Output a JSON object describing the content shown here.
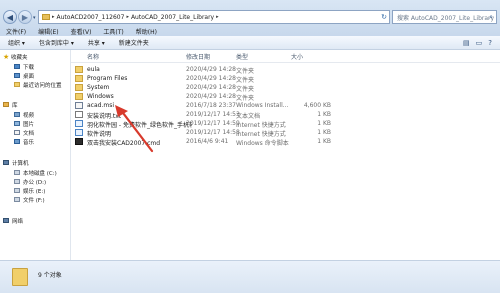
{
  "address": {
    "crumbs": [
      "AutoACD2007_112607",
      "AutoCAD_2007_Lite_Library"
    ]
  },
  "search": {
    "placeholder": "搜索 AutoCAD_2007_Lite_Library"
  },
  "menu": {
    "items": [
      "文件(F)",
      "编辑(E)",
      "查看(V)",
      "工具(T)",
      "帮助(H)"
    ]
  },
  "toolbar": {
    "organize": "组织 ▾",
    "include": "包含到库中 ▾",
    "share": "共享 ▾",
    "new_folder": "新建文件夹"
  },
  "sidebar": {
    "favorites": "收藏夹",
    "favorites_items": [
      "下载",
      "桌面",
      "最近访问的位置"
    ],
    "libraries": "库",
    "libraries_items": [
      "视频",
      "图片",
      "文档",
      "音乐"
    ],
    "computer": "计算机",
    "computer_items": [
      "本地磁盘 (C:)",
      "办公 (D:)",
      "娱乐 (E:)",
      "文件 (F:)"
    ],
    "network": "网络"
  },
  "columns": {
    "name": "名称",
    "date": "修改日期",
    "type": "类型",
    "size": "大小"
  },
  "files": [
    {
      "name": "eula",
      "date": "2020/4/29 14:28",
      "type": "文件夹",
      "size": "",
      "icon": "folder"
    },
    {
      "name": "Program Files",
      "date": "2020/4/29 14:28",
      "type": "文件夹",
      "size": "",
      "icon": "folder"
    },
    {
      "name": "System",
      "date": "2020/4/29 14:28",
      "type": "文件夹",
      "size": "",
      "icon": "folder"
    },
    {
      "name": "Windows",
      "date": "2020/4/29 14:28",
      "type": "文件夹",
      "size": "",
      "icon": "folder"
    },
    {
      "name": "acad.msi",
      "date": "2016/7/18 23:37",
      "type": "Windows Install...",
      "size": "4,600 KB",
      "icon": "msi"
    },
    {
      "name": "安装说明.txt",
      "date": "2019/12/17 14:53",
      "type": "文本文档",
      "size": "1 KB",
      "icon": "txt"
    },
    {
      "name": "羽化软件园 - 免费软件_绿色软件_手机软...",
      "date": "2019/12/17 14:59",
      "type": "Internet 快捷方式",
      "size": "1 KB",
      "icon": "inet"
    },
    {
      "name": "软件说明",
      "date": "2019/12/17 14:58",
      "type": "Internet 快捷方式",
      "size": "1 KB",
      "icon": "inet"
    },
    {
      "name": "双击我安装CAD2007.cmd",
      "date": "2016/4/6 9:41",
      "type": "Windows 命令脚本",
      "size": "1 KB",
      "icon": "cmd"
    }
  ],
  "status": {
    "count": "9 个对象"
  },
  "colors": {
    "accent": "#2f6aa8",
    "arrow": "#d83a2c",
    "folder": "#f1cf6a"
  }
}
